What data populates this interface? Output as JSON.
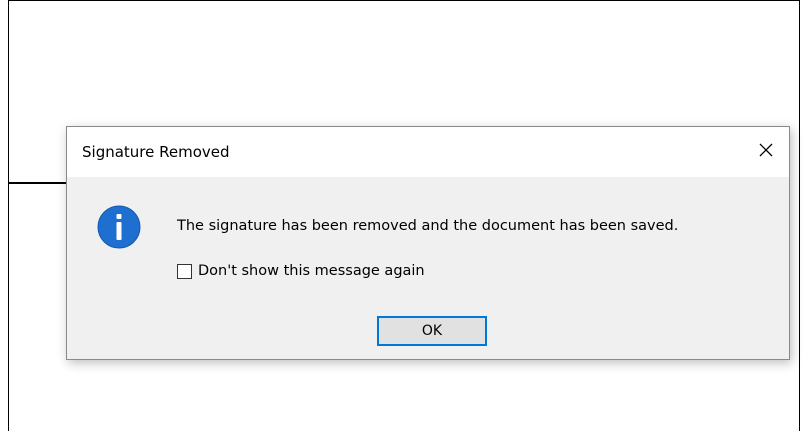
{
  "dialog": {
    "title": "Signature Removed",
    "message": "The signature has been removed and the document has been saved.",
    "checkbox_label": "Don't show this message again",
    "checkbox_checked": false,
    "ok_label": "OK",
    "icon": "info-icon",
    "close_icon": "close-icon"
  },
  "colors": {
    "accent": "#0078d7",
    "dialog_bg": "#f0f0f0",
    "titlebar_bg": "#ffffff"
  }
}
